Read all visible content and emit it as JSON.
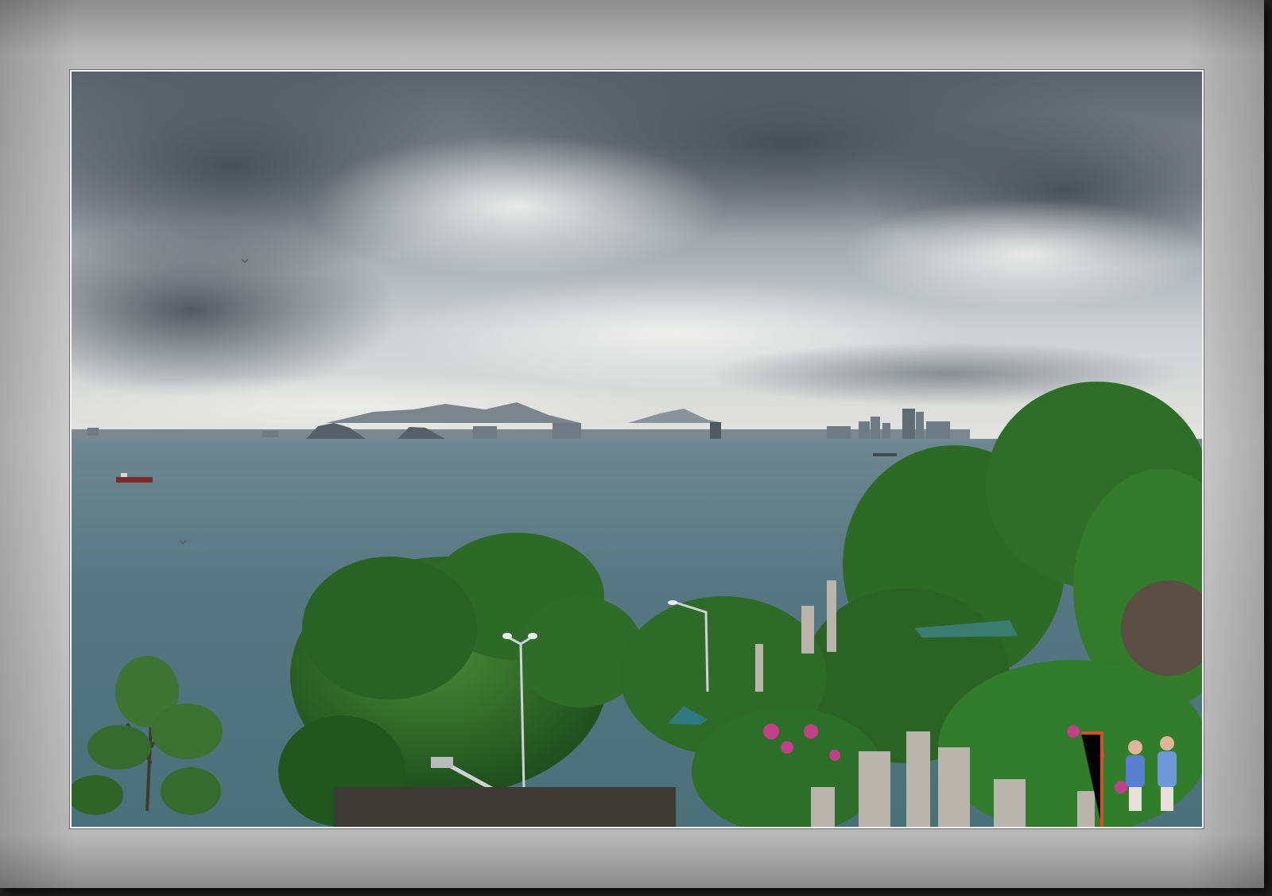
{
  "scene": {
    "description_tags": [
      "overcast-sky",
      "sea-bay",
      "distant-city-skyline",
      "mountains",
      "trees",
      "temple-statues",
      "visitors"
    ],
    "colors": {
      "sky_dark": "#4d5660",
      "sky_light": "#dfe2e3",
      "sea": "#4f6c76",
      "foliage": "#2f6b2a",
      "frame": "#c4c4c4"
    }
  }
}
